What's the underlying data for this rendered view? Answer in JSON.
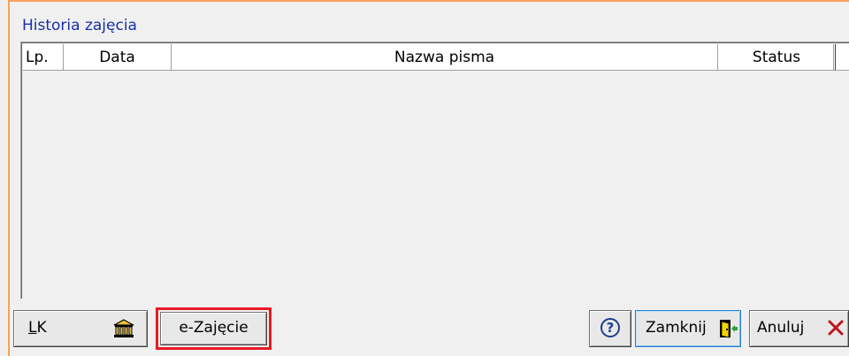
{
  "group": {
    "title": "Historia zajęcia"
  },
  "table": {
    "columns": [
      "Lp.",
      "Data",
      "Nazwa pisma",
      "Status"
    ],
    "rows": []
  },
  "buttons": {
    "lk_label": "LK",
    "lk_icon": "bank-icon",
    "ezajecie_label": "e-Zajęcie",
    "ezajecie_highlight_color": "#e61b23",
    "help_icon": "help-icon",
    "close_label": "Zamknij",
    "close_icon": "exit-door-icon",
    "cancel_label": "Anuluj",
    "cancel_icon": "cancel-x-icon"
  },
  "colors": {
    "group_title": "#1630a8",
    "window_accent": "#f5a15c",
    "cancel_x": "#c0141c"
  }
}
